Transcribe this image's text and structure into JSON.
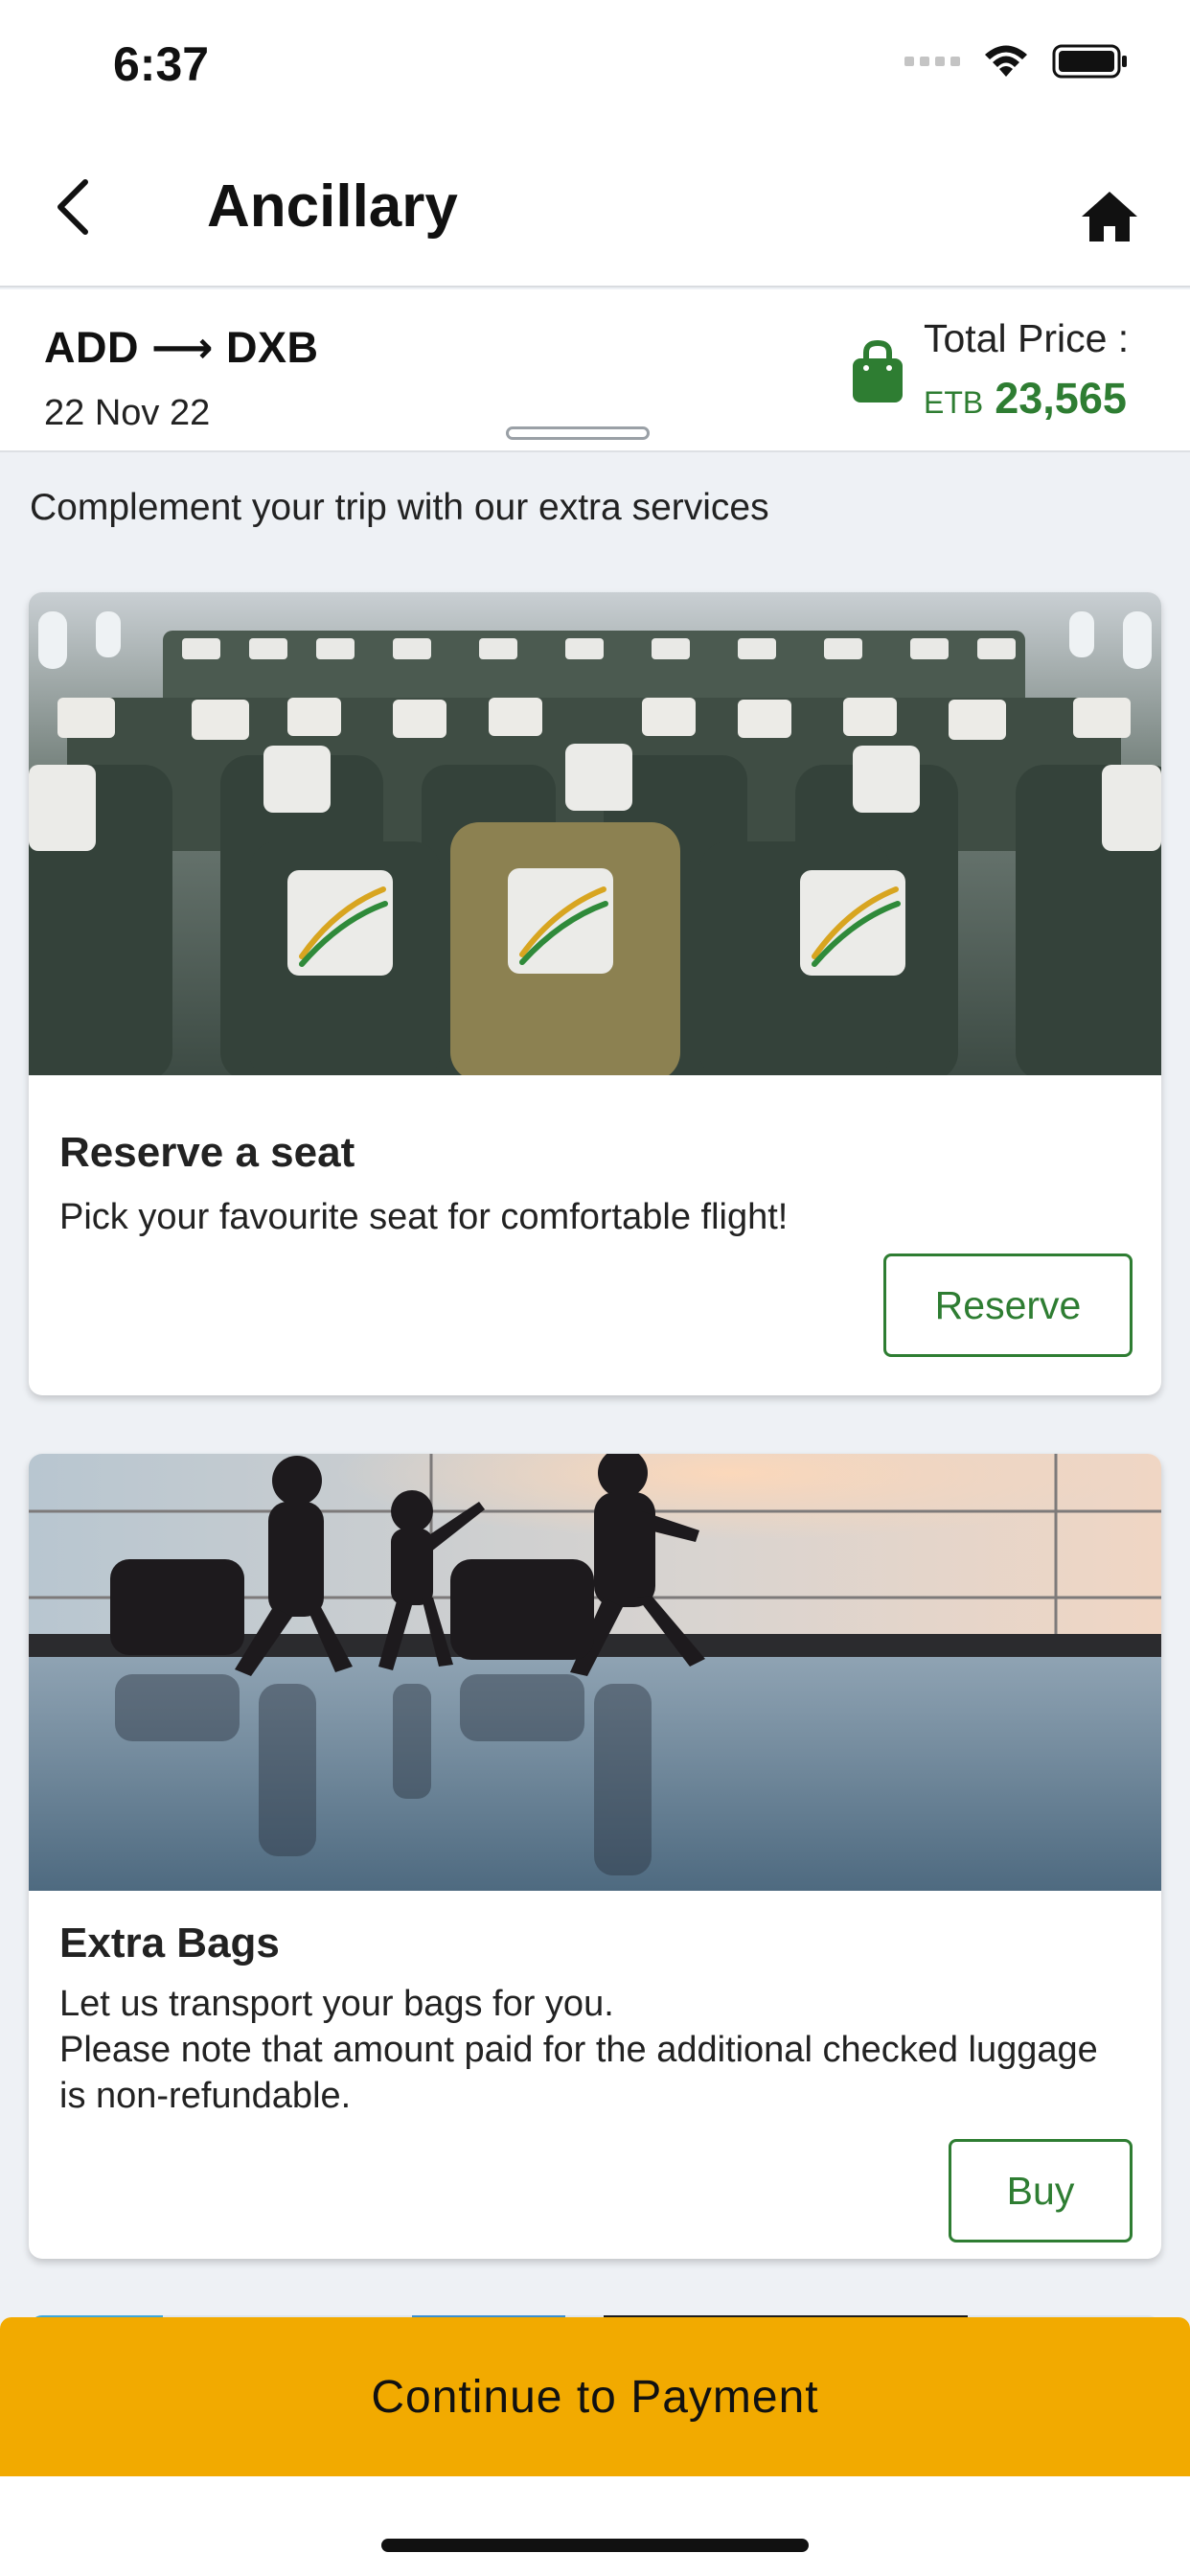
{
  "status_bar": {
    "time": "6:37"
  },
  "nav": {
    "title": "Ancillary"
  },
  "summary": {
    "route_from": "ADD",
    "route_arrow": "⟶",
    "route_to": "DXB",
    "date": "22 Nov 22",
    "total_label": "Total Price :",
    "currency": "ETB",
    "amount": "23,565"
  },
  "intro": "Complement your trip with our extra services",
  "cards": [
    {
      "title": "Reserve a seat",
      "description": "Pick your favourite seat for comfortable flight!",
      "button": "Reserve"
    },
    {
      "title": "Extra Bags",
      "description_line1": "Let us transport your bags for you.",
      "description_line2": "Please note that amount paid for the additional checked luggage is non-refundable.",
      "button": "Buy"
    }
  ],
  "continue_button": "Continue to Payment",
  "colors": {
    "accent_green": "#2e7d32",
    "cta_yellow": "#f2aa00",
    "background": "#eef1f5"
  }
}
